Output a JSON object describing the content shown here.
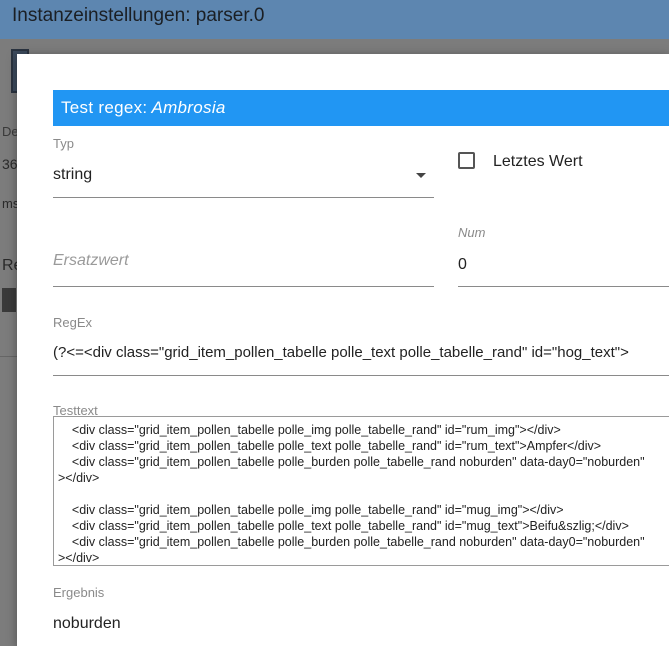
{
  "background": {
    "window_title": "Instanzeinstellungen: parser.0",
    "fragments": {
      "de": "De",
      "num": "36",
      "ms": "ms",
      "re": "Re"
    }
  },
  "dialog": {
    "title_prefix": "Test regex:",
    "title_name": "Ambrosia",
    "type": {
      "label": "Typ",
      "value": "string"
    },
    "last_value": {
      "label": "Letztes Wert",
      "checked": false
    },
    "substitute": {
      "placeholder": "Ersatzwert"
    },
    "num": {
      "label": "Num",
      "value": "0"
    },
    "regex": {
      "label": "RegEx",
      "value": "(?<=<div class=\"grid_item_pollen_tabelle polle_text polle_tabelle_rand\" id=\"hog_text\">"
    },
    "testtext": {
      "label": "Testtext",
      "lines": [
        "    <div class=\"grid_item_pollen_tabelle polle_img polle_tabelle_rand\" id=\"rum_img\"></div>",
        "    <div class=\"grid_item_pollen_tabelle polle_text polle_tabelle_rand\" id=\"rum_text\">Ampfer</div>",
        "    <div class=\"grid_item_pollen_tabelle polle_burden polle_tabelle_rand noburden\" data-day0=\"noburden\"",
        "></div>",
        "",
        "    <div class=\"grid_item_pollen_tabelle polle_img polle_tabelle_rand\" id=\"mug_img\"></div>",
        "    <div class=\"grid_item_pollen_tabelle polle_text polle_tabelle_rand\" id=\"mug_text\">Beifu&szlig;</div>",
        "    <div class=\"grid_item_pollen_tabelle polle_burden polle_tabelle_rand noburden\" data-day0=\"noburden\"",
        "></div>"
      ]
    },
    "result": {
      "label": "Ergebnis",
      "value": "noburden"
    }
  }
}
